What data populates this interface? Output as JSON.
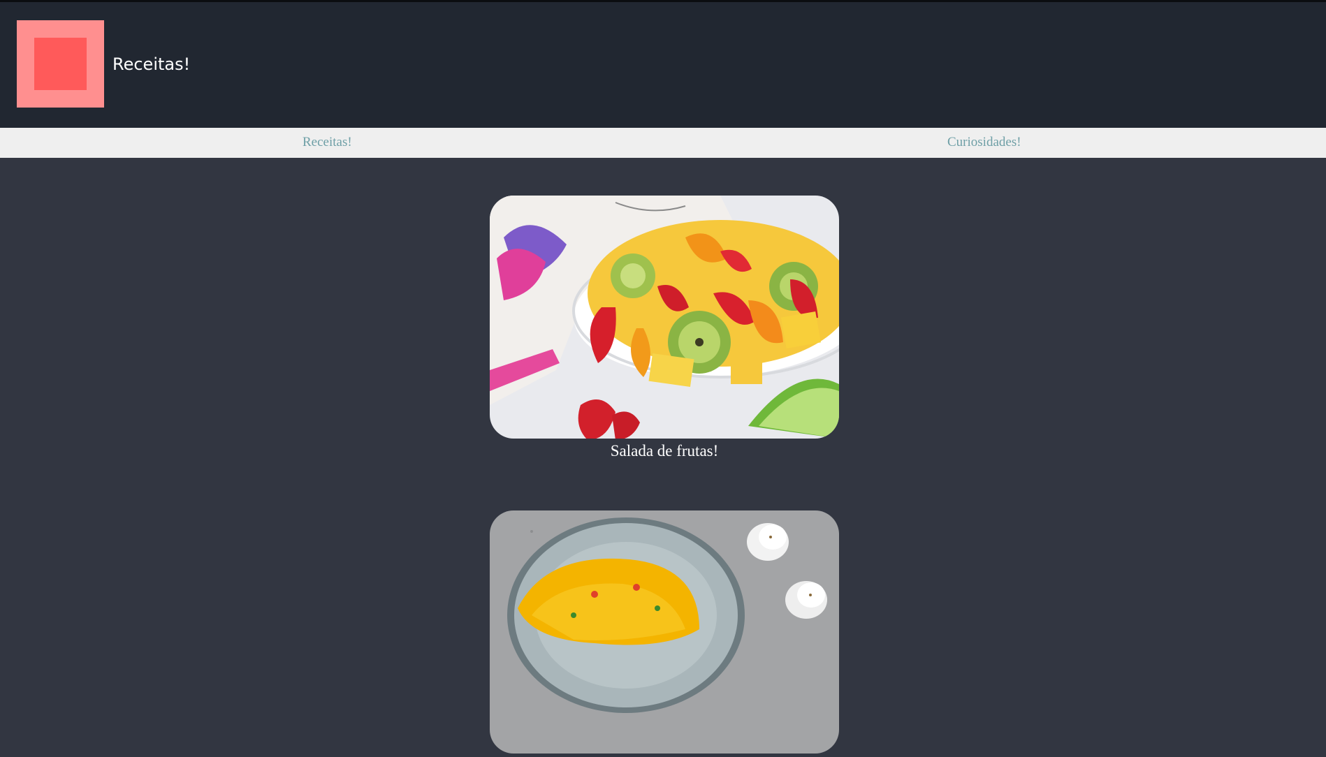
{
  "header": {
    "title": "Receitas!",
    "logo_icon": "logo-square-icon",
    "logo_outer_color": "#ff8f8f",
    "logo_inner_color": "#ff5a5a"
  },
  "nav": {
    "items": [
      {
        "label": "Receitas!"
      },
      {
        "label": "Curiosidades!"
      }
    ],
    "link_color": "#6e9fa6"
  },
  "recipes": [
    {
      "caption": "Salada de frutas!",
      "image": "fruit-salad-photo"
    },
    {
      "caption": "",
      "image": "omelette-photo"
    }
  ]
}
